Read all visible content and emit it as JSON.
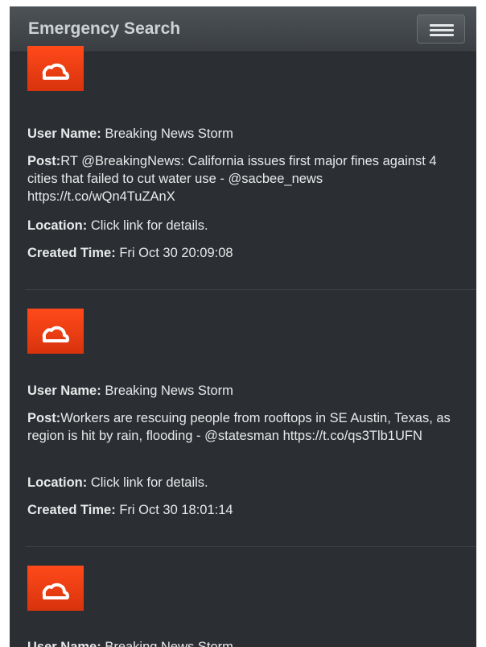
{
  "header": {
    "title": "Emergency Search"
  },
  "labels": {
    "user_name": "User Name:",
    "post": "Post:",
    "location": "Location:",
    "created_time": "Created Time:"
  },
  "colors": {
    "logo": "#e93d12",
    "background": "#2b2f33",
    "navbar": "#44484c"
  },
  "posts": [
    {
      "user_name": "Breaking News Storm",
      "post_text": "RT @BreakingNews: California issues first major fines against 4 cities that failed to cut water use - @sacbee_news",
      "post_link": "https://t.co/wQn4TuZAnX",
      "location": "Click link for details.",
      "created_time": "Fri Oct 30 20:09:08"
    },
    {
      "user_name": "Breaking News Storm",
      "post_text": "Workers are rescuing people from rooftops in SE Austin, Texas, as region is hit by rain, flooding - @statesman",
      "post_link": "https://t.co/qs3Tlb1UFN",
      "location": "Click link for details.",
      "created_time": "Fri Oct 30 18:01:14"
    },
    {
      "user_name": "Breaking News Storm"
    }
  ]
}
